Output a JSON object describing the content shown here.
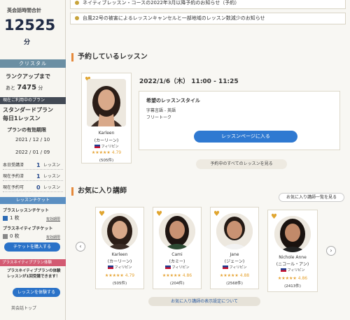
{
  "sidebar": {
    "total_label": "英会話時間合計",
    "total_value": "12525",
    "total_unit": "分",
    "rank": "クリスタル",
    "rankup_label": "ランクアップまで",
    "rankup_prefix": "あと",
    "rankup_value": "7475",
    "rankup_unit": "分",
    "plan_header": "現在ご利用中のプラン",
    "plan_name": "スタンダードプラン",
    "plan_freq": "毎日1レッスン",
    "expiry_label": "プランの有効期限",
    "expiry_from": "2021 / 12 / 10",
    "expiry_to": "2022 / 01 / 09",
    "counts": [
      {
        "label": "本日受講済",
        "num": "1",
        "unit": "レッスン"
      },
      {
        "label": "現在予約済",
        "num": "1",
        "unit": "レッスン"
      },
      {
        "label": "現在予約可",
        "num": "0",
        "unit": "レッスン"
      }
    ],
    "ticket_header": "レッスンチケット",
    "ticket_a_label": "プラスレッスンチケット",
    "ticket_a_count": "1 枚",
    "ticket_b_label": "プラスネイティブチケット",
    "ticket_b_count": "0 枚",
    "detail_link": "有効期限",
    "buy_button": "チケットを購入する",
    "promo_header": "プラスネイティブプラン体験",
    "promo_text": "プラスネイティブプランの体験レッスンが1回受講できます！",
    "promo_button": "レッスンを体験する",
    "top_link": "英会話トップ"
  },
  "notices": [
    "ネイティブレッスン・コースの2022年3月以降予約のお知らせ（予約）",
    "台風22号の被害によるレッスンキャンセルと一部地域のレッスン数減少のお知らせ"
  ],
  "reserved": {
    "section_title": "予約しているレッスン",
    "tutor": {
      "name": "Karleen",
      "kana": "(カーリーン)",
      "country": "フィリピン",
      "stars": "★★★★★",
      "rating": "4.79",
      "reviews": "(505件)"
    },
    "date": "2022/1/6（木）",
    "time": "11:00 - 11:25",
    "style_title": "希望のレッスンスタイル",
    "style_items": [
      "字幕言語 - 英語",
      "フリートーク"
    ],
    "enter_button": "レッスンページに入る",
    "all_button": "予約中のすべてのレッスンを見る"
  },
  "favorites": {
    "section_title": "お気に入り講師",
    "list_link": "お気に入り講師一覧を見る",
    "settings_button": "お気に入り講師の表示設定について",
    "tutors": [
      {
        "name": "Karleen",
        "kana": "(カーリーン)",
        "country": "フィリピン",
        "stars": "★★★★★",
        "rating": "4.79",
        "reviews": "(505件)"
      },
      {
        "name": "Cami",
        "kana": "(カミー)",
        "country": "フィリピン",
        "stars": "★★★★★",
        "rating": "4.86",
        "reviews": "(204件)"
      },
      {
        "name": "Jane",
        "kana": "(ジェーン)",
        "country": "フィリピン",
        "stars": "★★★★★",
        "rating": "4.88",
        "reviews": "(2568件)"
      },
      {
        "name": "Nichole Anne",
        "kana": "(ニコール・アン)",
        "country": "フィリピン",
        "stars": "★★★★★",
        "rating": "4.86",
        "reviews": "(2413件)"
      }
    ]
  },
  "icons": {
    "heart": "heart-icon",
    "prev": "chevron-left-icon",
    "next": "chevron-right-icon",
    "flag": "philippines-flag-icon"
  },
  "colors": {
    "accent": "#2f79d1",
    "section_bar": "#e5893b",
    "rank_bar": "#6b8fa3",
    "promo": "#d35a72"
  }
}
